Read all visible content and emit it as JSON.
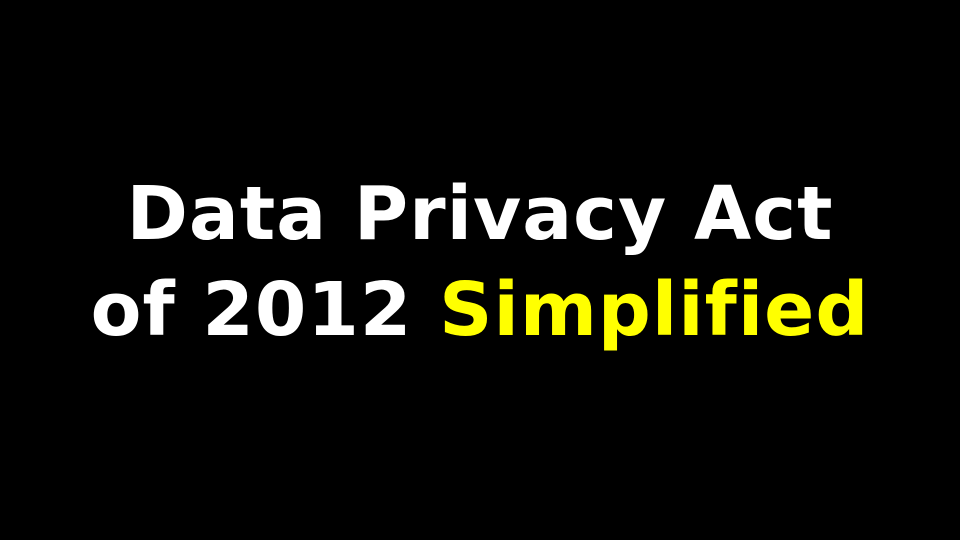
{
  "title": {
    "line1": "Data Privacy Act",
    "line2_prefix": "of 2012",
    "line2_highlight": "Simplified"
  },
  "colors": {
    "background": "#000000",
    "text": "#ffffff",
    "highlight": "#ffff00"
  }
}
